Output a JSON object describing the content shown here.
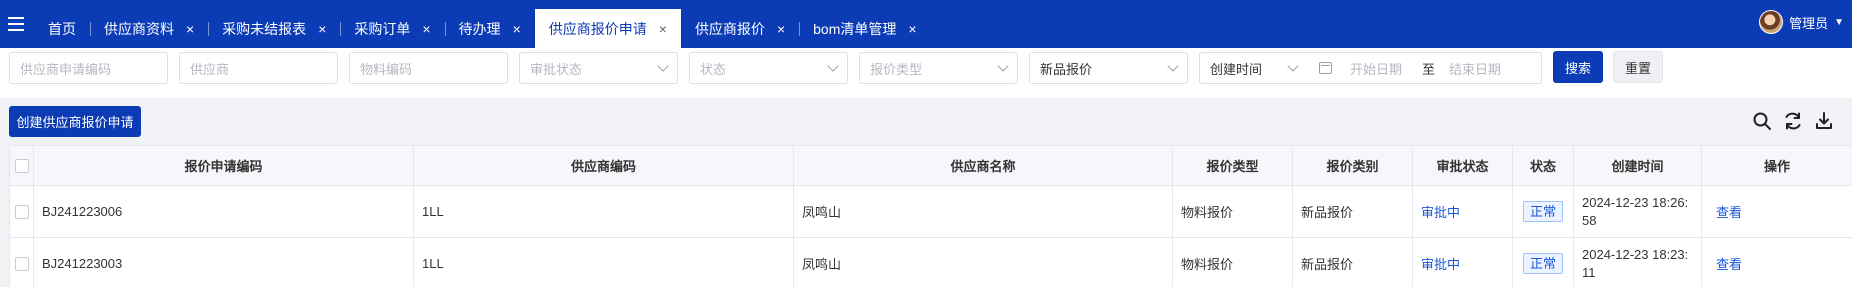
{
  "topbar": {
    "tabs": [
      {
        "label": "首页",
        "closable": false,
        "active": false
      },
      {
        "label": "供应商资料",
        "closable": true,
        "active": false
      },
      {
        "label": "采购未结报表",
        "closable": true,
        "active": false
      },
      {
        "label": "采购订单",
        "closable": true,
        "active": false
      },
      {
        "label": "待办理",
        "closable": true,
        "active": false
      },
      {
        "label": "供应商报价申请",
        "closable": true,
        "active": true
      },
      {
        "label": "供应商报价",
        "closable": true,
        "active": false
      },
      {
        "label": "bom清单管理",
        "closable": true,
        "active": false
      }
    ],
    "close_glyph": "×",
    "user": {
      "name": "管理员",
      "caret": "▼"
    }
  },
  "filters": {
    "apply_code_placeholder": "供应商申请编码",
    "supplier_placeholder": "供应商",
    "material_code_placeholder": "物料编码",
    "approval_status_placeholder": "审批状态",
    "status_placeholder": "状态",
    "quote_type_placeholder": "报价类型",
    "quote_category_value": "新品报价",
    "date_field_value": "创建时间",
    "date_start_placeholder": "开始日期",
    "date_separator": "至",
    "date_end_placeholder": "结束日期",
    "search_label": "搜索",
    "reset_label": "重置"
  },
  "toolbar": {
    "create_label": "创建供应商报价申请",
    "icons": [
      "search-icon",
      "refresh-icon",
      "download-icon"
    ]
  },
  "table": {
    "headers": {
      "code": "报价申请编码",
      "supplier_code": "供应商编码",
      "supplier_name": "供应商名称",
      "quote_type": "报价类型",
      "quote_category": "报价类别",
      "approval_status": "审批状态",
      "status": "状态",
      "created_at": "创建时间",
      "actions": "操作"
    },
    "rows": [
      {
        "code": "BJ241223006",
        "supplier_code": "1LL",
        "supplier_name": "凤鸣山",
        "quote_type": "物料报价",
        "quote_category": "新品报价",
        "approval_status": "审批中",
        "status": "正常",
        "created_at": "2024-12-23 18:26:58",
        "action": "查看"
      },
      {
        "code": "BJ241223003",
        "supplier_code": "1LL",
        "supplier_name": "凤鸣山",
        "quote_type": "物料报价",
        "quote_category": "新品报价",
        "approval_status": "审批中",
        "status": "正常",
        "created_at": "2024-12-23 18:23:11",
        "action": "查看"
      }
    ]
  },
  "colors": {
    "brand": "#0b3bb5",
    "link": "#1a56d6",
    "badge_bg": "#eaf3ff",
    "badge_border": "#9ec3ff"
  }
}
